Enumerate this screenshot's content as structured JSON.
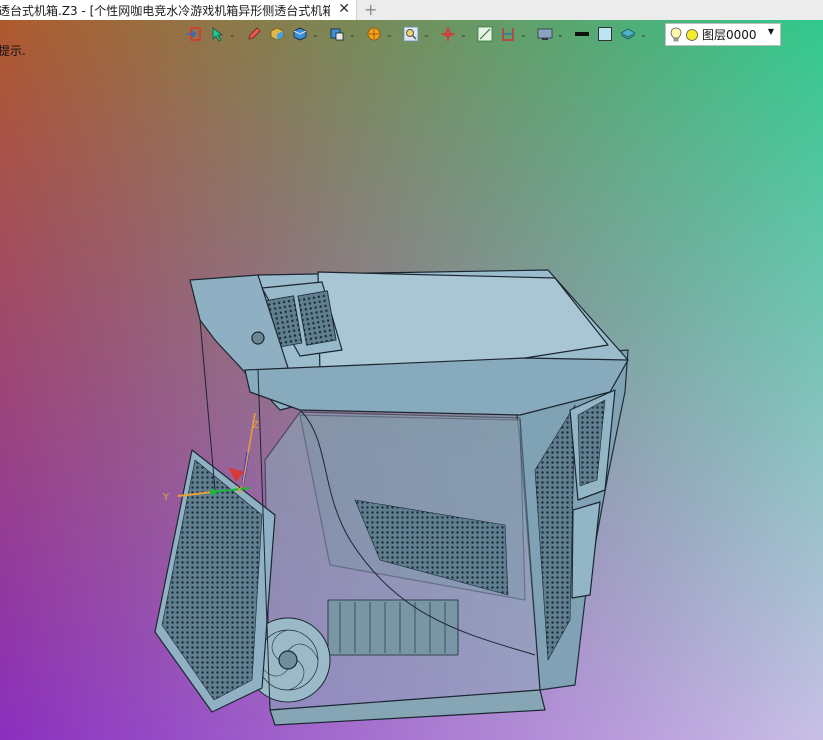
{
  "tab": {
    "title": "透台式机箱.Z3 - [个性网咖电竞水冷游戏机箱异形侧透台式机箱]",
    "close_label": "✕",
    "new_tab_label": "+"
  },
  "hint_text": "提示.",
  "toolbar": {
    "icons": [
      "exit-icon",
      "pick-icon",
      "pencil-icon",
      "cube-shade-icon",
      "cube-icon",
      "view-cube-icon",
      "filter-icon",
      "zoom-icon",
      "origin-icon",
      "measure-icon",
      "section-icon",
      "display-icon",
      "line-style-icon",
      "color-box-icon",
      "layer-stack-icon"
    ],
    "layer": {
      "name": "图层0000"
    }
  },
  "colors": {
    "bg_top_left": "#b05a2e",
    "bg_top_right": "#32c98d",
    "bg_bottom_left": "#8a2fbf",
    "bg_bottom_right": "#c9bfe6",
    "model_fill": "#8fb4c6",
    "model_stroke": "#1b2630"
  },
  "triad": {
    "x_label": "X",
    "y_label": "Y",
    "z_label": "Z"
  }
}
